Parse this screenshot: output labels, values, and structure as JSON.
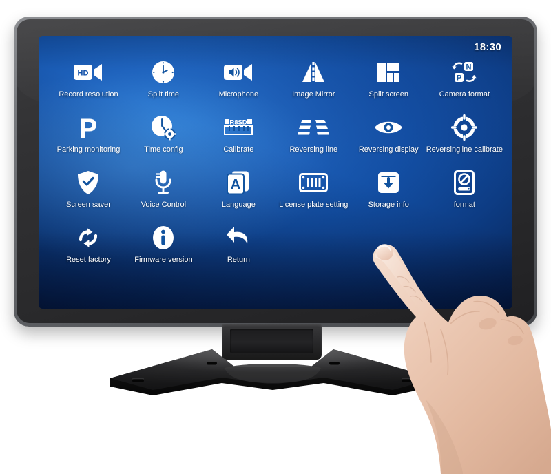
{
  "device": {
    "type": "touchscreen-car-monitor",
    "bezel_color": "#2e2e30",
    "frame_color": "#76787c",
    "stand_color": "#1b1b1c"
  },
  "screen": {
    "background_accent": "#1f63bd",
    "background_dark": "#04163a",
    "text_color": "#ffffff",
    "status_bar": {
      "time": "18:30"
    },
    "menu": {
      "columns": 6,
      "items": [
        {
          "label": "Record resolution",
          "icon": "hd-camcorder-icon"
        },
        {
          "label": "Split time",
          "icon": "clock-icon"
        },
        {
          "label": "Microphone",
          "icon": "speaker-camcorder-icon"
        },
        {
          "label": "Image Mirror",
          "icon": "mirror-triangles-icon"
        },
        {
          "label": "Split screen",
          "icon": "split-screen-layout-icon"
        },
        {
          "label": "Camera format",
          "icon": "np-format-arrows-icon"
        },
        {
          "label": "Parking monitoring",
          "icon": "letter-p-icon"
        },
        {
          "label": "Time config",
          "icon": "clock-gear-icon"
        },
        {
          "label": "Calibrate",
          "icon": "r8sd-ruler-icon"
        },
        {
          "label": "Reversing line",
          "icon": "parking-guide-lines-icon"
        },
        {
          "label": "Reversing display",
          "icon": "eye-icon"
        },
        {
          "label": "Reversingline calibrate",
          "icon": "crosshair-target-icon"
        },
        {
          "label": "Screen saver",
          "icon": "shield-check-icon"
        },
        {
          "label": "Voice Control",
          "icon": "microphone-icon"
        },
        {
          "label": "Language",
          "icon": "letter-a-cards-icon"
        },
        {
          "label": "License plate setting",
          "icon": "license-plate-icon"
        },
        {
          "label": "Storage info",
          "icon": "download-box-icon"
        },
        {
          "label": "format",
          "icon": "disk-prohibited-icon"
        },
        {
          "label": "Reset factory",
          "icon": "refresh-cycle-icon"
        },
        {
          "label": "Firmware version",
          "icon": "info-circle-icon"
        },
        {
          "label": "Return",
          "icon": "back-arrow-icon"
        }
      ]
    }
  },
  "overlay": {
    "hand": "pointing-hand-index-finger",
    "hand_skin_color": "#e8c3ad"
  }
}
